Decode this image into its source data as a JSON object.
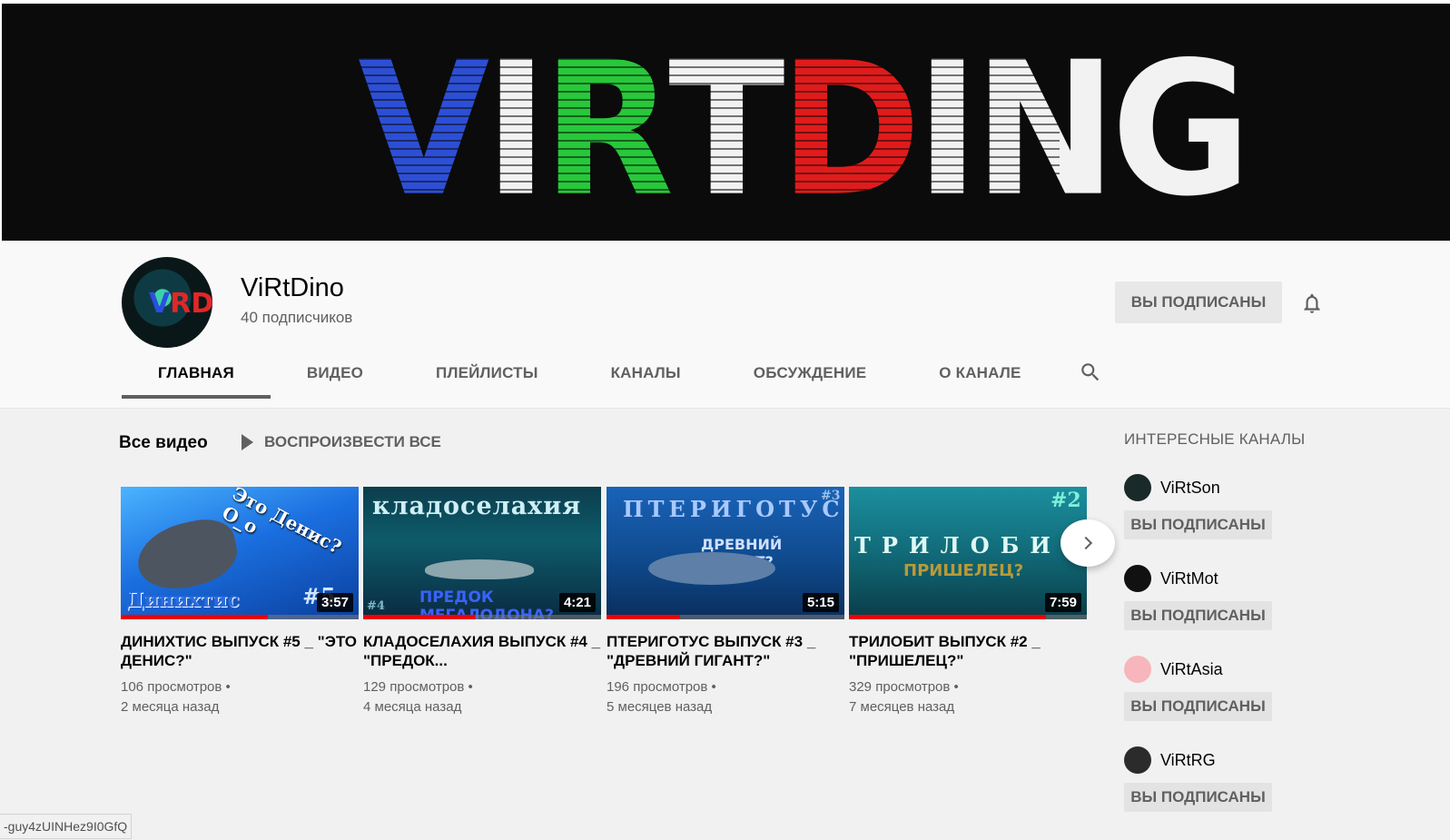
{
  "banner": {
    "letters": [
      "V",
      "I",
      "R",
      "T",
      "D",
      "I",
      "N",
      "G"
    ]
  },
  "channel": {
    "name": "ViRtDino",
    "subscribers": "40 подписчиков",
    "subscribe_label": "ВЫ ПОДПИСАНЫ"
  },
  "tabs": [
    {
      "label": "ГЛАВНАЯ"
    },
    {
      "label": "ВИДЕО"
    },
    {
      "label": "ПЛЕЙЛИСТЫ"
    },
    {
      "label": "КАНАЛЫ"
    },
    {
      "label": "ОБСУЖДЕНИЕ"
    },
    {
      "label": "О КАНАЛЕ"
    }
  ],
  "shelf": {
    "title": "Все видео",
    "play_all": "ВОСПРОИЗВЕСТИ ВСЕ"
  },
  "videos": [
    {
      "title": "ДИНИХТИС ВЫПУСК #5 _ \"ЭТО ДЕНИС?\"",
      "duration": "3:57",
      "views": "106 просмотров",
      "date": "2 месяца назад",
      "watched": 0.62,
      "thumb_top": "Это Денис?O_o",
      "thumb_bottom": "Динихтис",
      "thumb_tag": "#5"
    },
    {
      "title": "КЛАДОСЕЛАХИЯ ВЫПУСК #4 _ \"ПРЕДОК...",
      "duration": "4:21",
      "views": "129 просмотров",
      "date": "4 месяца назад",
      "watched": 0.47,
      "thumb_top": "кладоселахия",
      "thumb_bottom": "ПРЕДОК МЕГАЛОДОНА?",
      "thumb_tag": "#4"
    },
    {
      "title": "ПТЕРИГОТУС ВЫПУСК #3 _ \"ДРЕВНИЙ ГИГАНТ?\"",
      "duration": "5:15",
      "views": "196 просмотров",
      "date": "5 месяцев назад",
      "watched": 0.31,
      "thumb_top": "ПТЕРИГОТУС",
      "thumb_bottom": "ДРЕВНИЙ ГИГАНТ?",
      "thumb_tag": "#3"
    },
    {
      "title": "ТРИЛОБИТ ВЫПУСК #2 _ \"ПРИШЕЛЕЦ?\"",
      "duration": "7:59",
      "views": "329 просмотров",
      "date": "7 месяцев назад",
      "watched": 0.83,
      "thumb_top": "ТРИЛОБИТ",
      "thumb_bottom": "ПРИШЕЛЕЦ?",
      "thumb_tag": "#2"
    }
  ],
  "sidebar": {
    "title": "ИНТЕРЕСНЫЕ КАНАЛЫ",
    "channels": [
      {
        "name": "ViRtSon",
        "button": "ВЫ ПОДПИСАНЫ",
        "color": "#1a2a2a"
      },
      {
        "name": "ViRtMot",
        "button": "ВЫ ПОДПИСАНЫ",
        "color": "#111111"
      },
      {
        "name": "ViRtAsia",
        "button": "ВЫ ПОДПИСАНЫ",
        "color": "#f7b6bb"
      },
      {
        "name": "ViRtRG",
        "button": "ВЫ ПОДПИСАНЫ",
        "color": "#2b2b2b"
      }
    ]
  },
  "status_bar": {
    "url": "-guy4zUINHez9I0GfQ"
  },
  "colors": {
    "accent_red": "#e00000",
    "tab_indicator": "#606060",
    "banner_bg": "#0b0b0b"
  }
}
